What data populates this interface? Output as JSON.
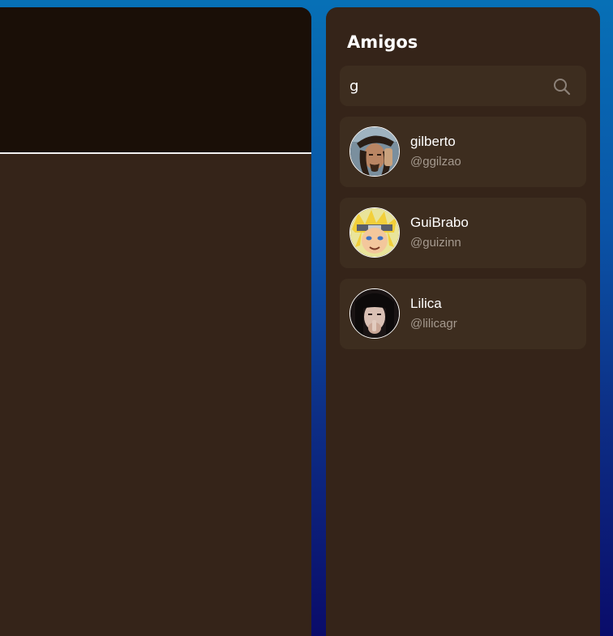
{
  "friends_panel": {
    "title": "Amigos",
    "search": {
      "value": "g",
      "icon": "search-icon"
    },
    "friends": [
      {
        "name": "gilberto",
        "handle": "@ggilzao",
        "avatar": "pirate-avatar"
      },
      {
        "name": "GuiBrabo",
        "handle": "@guizinn",
        "avatar": "anime-ninja-avatar"
      },
      {
        "name": "Lilica",
        "handle": "@lilicagr",
        "avatar": "dark-hair-avatar"
      }
    ]
  },
  "colors": {
    "panel_background": "#352419",
    "card_background": "#3d2d1f",
    "banner_background": "#1a0f07",
    "handle_text": "#a59a8f",
    "page_background_top": "#0770b6",
    "page_background_bottom": "#0a0c6a"
  }
}
